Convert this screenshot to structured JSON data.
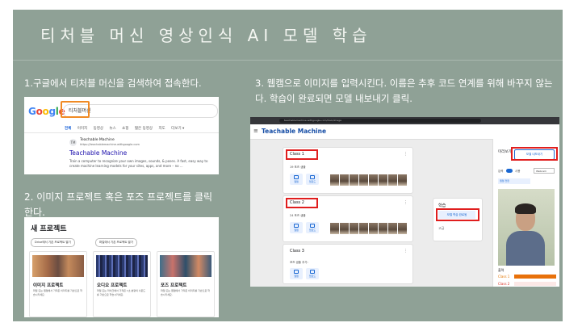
{
  "slide": {
    "title": "티처블 머신 영상인식 AI 모델 학습",
    "step1": "1.구글에서 티처블 머신을 검색하여 접속한다.",
    "step2": "2. 이미지 프로젝트 혹은 포즈 프로젝트를 클릭한다.",
    "step3": "3. 웹캠으로 이미지를 입력시킨다. 이름은 추후 코드 연계를 위해 바꾸지 않는다. 학습이 완료되면 모델 내보내기 클릭."
  },
  "google": {
    "logo": "Google",
    "query": "티처블머신",
    "tabs": [
      "전체",
      "이미지",
      "동영상",
      "뉴스",
      "쇼핑",
      "짧은 동영상",
      "지도",
      "더보기 ▾"
    ],
    "result_site": "Teachable Machine",
    "result_url": "https://teachablemachine.withgoogle.com",
    "result_title": "Teachable Machine",
    "result_snippet": "Train a computer to recognize your own images, sounds, & poses. A fast, easy way to create machine learning models for your sites, apps, and more – no ..."
  },
  "new_project": {
    "title": "새 프로젝트",
    "open_drive": "Drive에서 기존 프로젝트 열기",
    "open_file": "파일에서 기존 프로젝트 열기",
    "cards": [
      {
        "name": "이미지 프로젝트",
        "desc": "파일 또는 웹캠에서 가져온 이미지를 기반으로 학습시키세요."
      },
      {
        "name": "오디오 프로젝트",
        "desc": "파일 또는 마이크에서 가져온 1초 분량의 사운드를 기반으로 학습시키세요."
      },
      {
        "name": "포즈 프로젝트",
        "desc": "파일 또는 웹캠에서 가져온 이미지를 기반으로 학습시키세요."
      }
    ]
  },
  "teachable": {
    "url": "teachablemachine.withgoogle.com/train/image",
    "app_title": "Teachable Machine",
    "classes": [
      {
        "name": "Class 1",
        "samples": "19 포즈 샘플"
      },
      {
        "name": "Class 2",
        "samples": "24 포즈 샘플"
      },
      {
        "name": "Class 3",
        "samples": "포즈 샘플 추가:"
      }
    ],
    "webcam_label": "웹캠",
    "upload_label": "업로드",
    "training_title": "학습",
    "train_button": "모델 학습 완료됨",
    "advanced": "고급",
    "preview_label": "미리보기",
    "export_button": "모델 내보내기",
    "input_label": "입력",
    "input_state": "사용",
    "webcam_select": "Webcam",
    "camera_select": "웹캠 전환",
    "output_label": "출력",
    "outputs": [
      {
        "name": "Class 1",
        "value": 1.0,
        "label": "100%"
      },
      {
        "name": "Class 2",
        "value": 0.0,
        "label": ""
      }
    ]
  }
}
